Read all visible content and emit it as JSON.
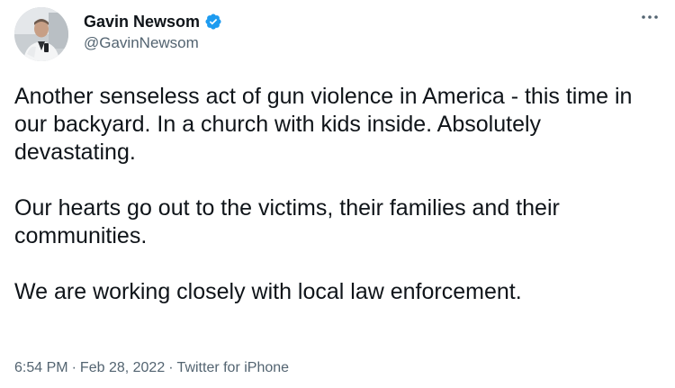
{
  "user": {
    "display_name": "Gavin Newsom",
    "handle": "@GavinNewsom",
    "verified": true,
    "verified_color": "#1d9bf0"
  },
  "tweet": {
    "paragraphs": [
      "Another senseless act of gun violence in America - this time in our backyard. In a church with kids inside. Absolutely devastating.",
      "Our hearts go out to the victims, their families and their communities.",
      "We are working closely with local law enforcement."
    ]
  },
  "meta": {
    "time": "6:54 PM",
    "separator": "·",
    "date": "Feb 28, 2022",
    "source": "Twitter for iPhone"
  },
  "icons": {
    "more": "more-horizontal-icon",
    "verified": "verified-badge-icon",
    "avatar": "profile-photo"
  },
  "colors": {
    "text": "#0f1419",
    "secondary_text": "#536471",
    "accent": "#1d9bf0"
  }
}
